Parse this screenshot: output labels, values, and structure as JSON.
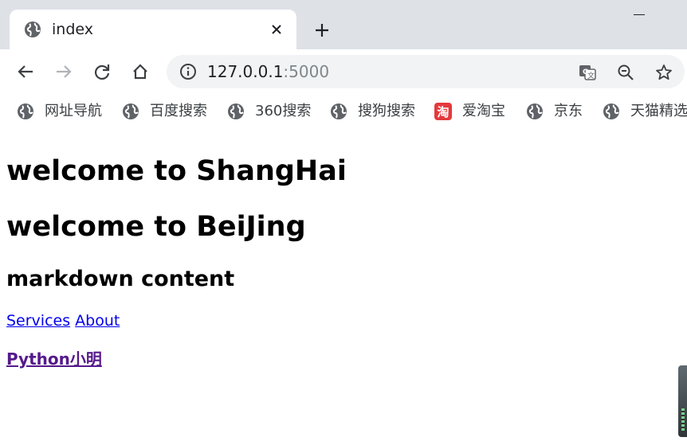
{
  "tab": {
    "title": "index"
  },
  "omnibox": {
    "host": "127.0.0.1",
    "port": ":5000"
  },
  "bookmarks": [
    {
      "label": "网址导航",
      "icon": "globe-icon"
    },
    {
      "label": "百度搜索",
      "icon": "globe-icon"
    },
    {
      "label": "360搜索",
      "icon": "globe-icon"
    },
    {
      "label": "搜狗搜索",
      "icon": "globe-icon"
    },
    {
      "label": "爱淘宝",
      "icon": "taobao-icon",
      "icon_glyph": "淘",
      "icon_color": "#e4393c"
    },
    {
      "label": "京东",
      "icon": "globe-icon"
    },
    {
      "label": "天猫精选",
      "icon": "globe-icon"
    }
  ],
  "content": {
    "heading1": "welcome to ShangHai",
    "heading2": "welcome to BeiJing",
    "heading3": "markdown content",
    "link_services": "Services",
    "link_about": "About",
    "strong_link": "Python小明"
  },
  "colors": {
    "tabstrip_bg": "#dee1e6",
    "omnibox_bg": "#f1f3f4",
    "link": "#0000ee",
    "visited_link": "#551a8b"
  }
}
